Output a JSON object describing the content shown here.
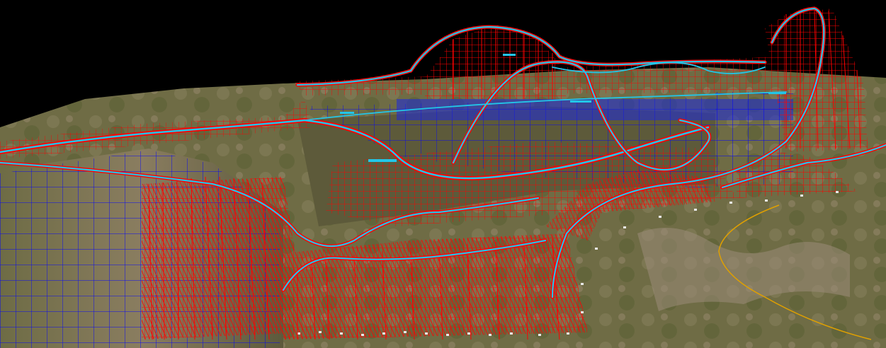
{
  "viewport": {
    "description_visible_text": "",
    "colors": {
      "sky": "#000000",
      "terrain_light": "#8c8a5a",
      "terrain_dark": "#5f6236",
      "terrain_rock": "#7a6a55",
      "support_structure": "#ff0000",
      "cliff_wireframe": "#0000ff",
      "track_rail": "#22c6e8",
      "path_line": "#e0a000"
    },
    "icons": [
      "terrain-mesh",
      "wireframe-supports",
      "track-rails"
    ]
  }
}
